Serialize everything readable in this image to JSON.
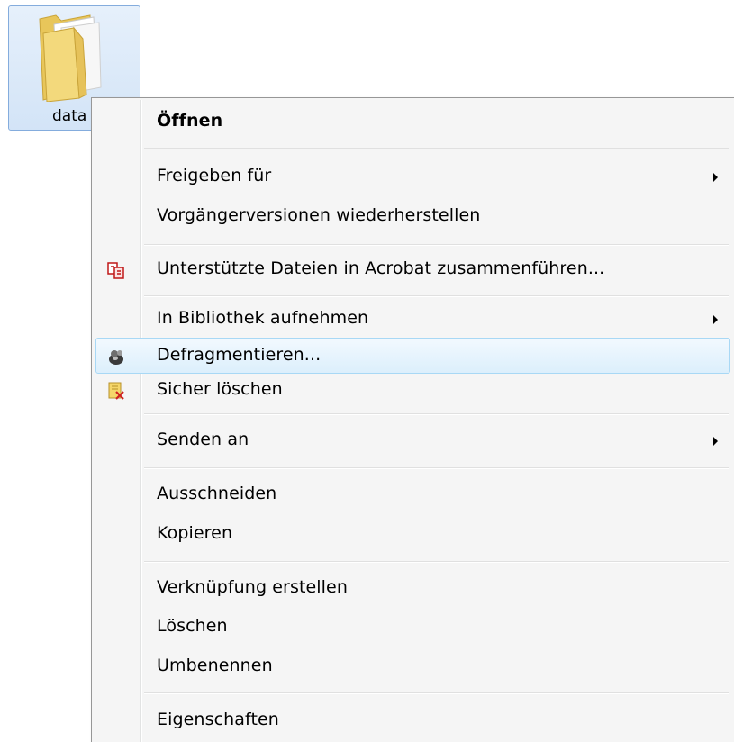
{
  "folder": {
    "name": "data"
  },
  "menu": {
    "items": [
      {
        "label": "Öffnen"
      },
      {
        "label": "Freigeben für"
      },
      {
        "label": "Vorgängerversionen wiederherstellen"
      },
      {
        "label": "Unterstützte Dateien in Acrobat zusammenführen..."
      },
      {
        "label": "In Bibliothek aufnehmen"
      },
      {
        "label": "Defragmentieren..."
      },
      {
        "label": "Sicher löschen"
      },
      {
        "label": "Senden an"
      },
      {
        "label": "Ausschneiden"
      },
      {
        "label": "Kopieren"
      },
      {
        "label": "Verknüpfung erstellen"
      },
      {
        "label": "Löschen"
      },
      {
        "label": "Umbenennen"
      },
      {
        "label": "Eigenschaften"
      }
    ],
    "icons": {
      "acrobat": "acrobat-combine-icon",
      "defrag": "defragment-icon",
      "secure_delete": "secure-delete-icon"
    },
    "hover_color": "#dceffc",
    "hover_border": "#a8d8f5"
  }
}
